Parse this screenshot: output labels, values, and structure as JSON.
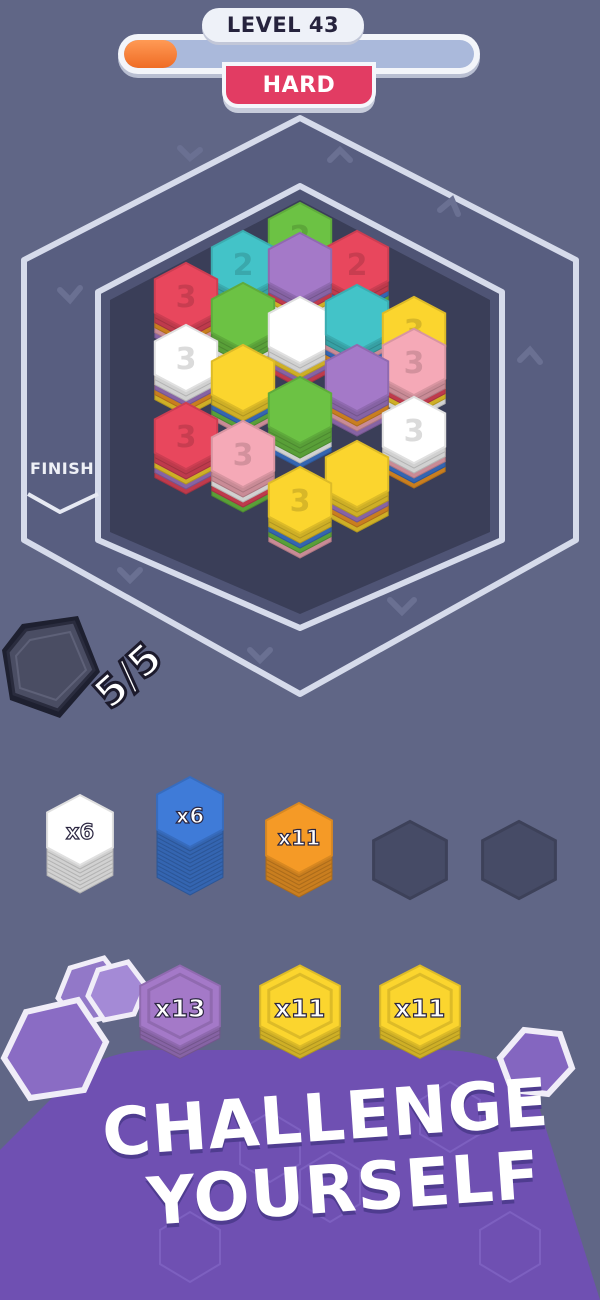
{
  "header": {
    "level_label": "LEVEL 43",
    "difficulty": "HARD",
    "progress_fraction": 0.15
  },
  "colors": {
    "background": "#606686",
    "board_outer": "#585e80",
    "track_line": "#d6dbeb",
    "board_inner": "#3a3e58",
    "red": "#e8475d",
    "teal": "#43c3c8",
    "green": "#6cc244",
    "purple": "#a479c8",
    "white": "#ffffff",
    "yellow": "#fbd52e",
    "pink": "#f5a9b7",
    "blue": "#3f7bd8",
    "orange": "#f59a26"
  },
  "track": {
    "finish_label": "FINISH"
  },
  "board": {
    "tiles": [
      {
        "color": "green",
        "label": "2"
      },
      {
        "color": "teal",
        "label": "2"
      },
      {
        "color": "red",
        "label": "2"
      },
      {
        "color": "purple",
        "label": ""
      },
      {
        "color": "red",
        "label": "3"
      },
      {
        "color": "green",
        "label": ""
      },
      {
        "color": "white",
        "label": ""
      },
      {
        "color": "teal",
        "label": ""
      },
      {
        "color": "yellow",
        "label": "3"
      },
      {
        "color": "white",
        "label": "3"
      },
      {
        "color": "yellow",
        "label": ""
      },
      {
        "color": "pink",
        "label": "3"
      },
      {
        "color": "purple",
        "label": ""
      },
      {
        "color": "green",
        "label": ""
      },
      {
        "color": "red",
        "label": "3"
      },
      {
        "color": "white",
        "label": "3"
      },
      {
        "color": "pink",
        "label": "3"
      },
      {
        "color": "yellow",
        "label": ""
      },
      {
        "color": "yellow",
        "label": "3"
      }
    ]
  },
  "dispenser": {
    "counter": "5/5"
  },
  "slots": [
    {
      "color": "white",
      "label": "x6",
      "empty": false
    },
    {
      "color": "blue",
      "label": "x6",
      "empty": false
    },
    {
      "color": "orange",
      "label": "x11",
      "empty": false
    },
    {
      "color": "",
      "label": "",
      "empty": true
    },
    {
      "color": "",
      "label": "",
      "empty": true
    }
  ],
  "tray": [
    {
      "color": "purple",
      "label": "x13"
    },
    {
      "color": "yellow",
      "label": "x11"
    },
    {
      "color": "yellow",
      "label": "x11"
    }
  ],
  "tagline": {
    "line1": "CHALLENGE",
    "line2": "YOURSELF"
  }
}
